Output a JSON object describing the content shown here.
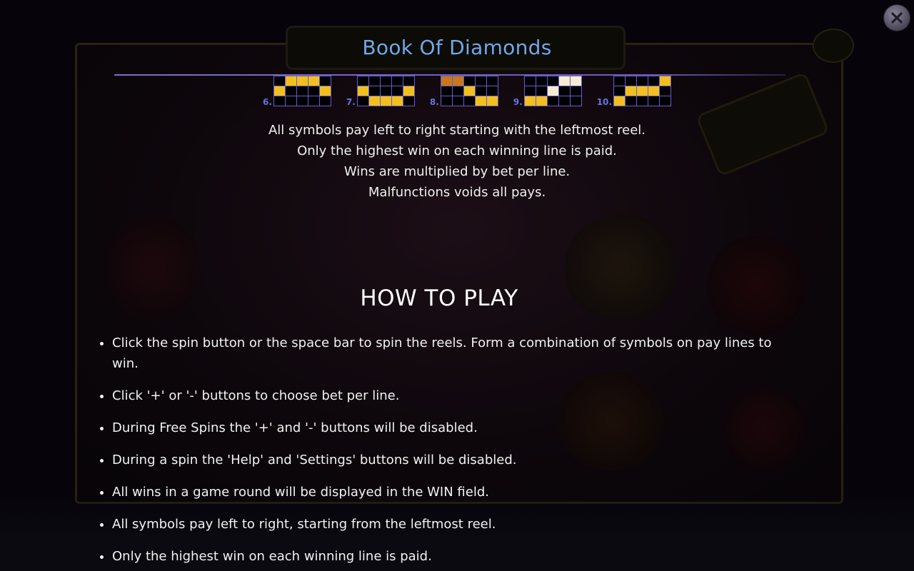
{
  "dialog": {
    "title": "Book Of Diamonds",
    "close_icon": "close-icon"
  },
  "paylines": [
    {
      "number": "6.",
      "cells": [
        [
          0,
          1,
          1,
          1,
          0
        ],
        [
          1,
          0,
          0,
          0,
          1
        ],
        [
          0,
          0,
          0,
          0,
          0
        ]
      ]
    },
    {
      "number": "7.",
      "cells": [
        [
          0,
          0,
          0,
          0,
          0
        ],
        [
          1,
          0,
          0,
          0,
          1
        ],
        [
          0,
          1,
          1,
          1,
          0
        ]
      ]
    },
    {
      "number": "8.",
      "cells": [
        [
          2,
          2,
          0,
          0,
          0
        ],
        [
          0,
          0,
          1,
          0,
          0
        ],
        [
          0,
          0,
          0,
          1,
          1
        ]
      ]
    },
    {
      "number": "9.",
      "cells": [
        [
          0,
          0,
          0,
          3,
          3
        ],
        [
          0,
          0,
          3,
          0,
          0
        ],
        [
          1,
          1,
          0,
          0,
          0
        ]
      ]
    },
    {
      "number": "10.",
      "cells": [
        [
          0,
          0,
          0,
          0,
          1
        ],
        [
          0,
          1,
          1,
          1,
          0
        ],
        [
          1,
          0,
          0,
          0,
          0
        ]
      ]
    }
  ],
  "rules": [
    "All symbols pay left to right starting with the leftmost reel.",
    "Only the highest win on each winning line is paid.",
    "Wins are multiplied by bet per line.",
    "Malfunctions voids all pays."
  ],
  "how_to_play": {
    "title": "HOW TO PLAY",
    "items": [
      "Click the spin button or the space bar to spin the reels. Form a combination of symbols on pay lines to win.",
      "Click '+' or '-' buttons to choose bet per line.",
      "During Free Spins the '+' and '-' buttons will be disabled.",
      "During a spin the 'Help' and 'Settings' buttons will be disabled.",
      "All wins in a game round will be displayed in the WIN field.",
      "All symbols pay left to right, starting from the leftmost reel.",
      "Only the highest win on each winning line is paid."
    ]
  },
  "colors": {
    "title": "#6fa8ea",
    "payline_on": "#f2c01c",
    "payline_grid": "#6a5ad0"
  }
}
